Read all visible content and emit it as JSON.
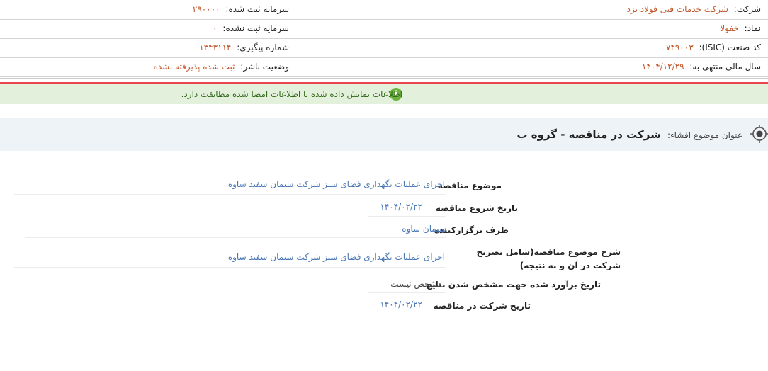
{
  "company_info": {
    "company_label": "شرکت:",
    "company_value": "شرکت خدمات فنی فولاد یزد",
    "symbol_label": "نماد:",
    "symbol_value": "خفولا",
    "isic_label": "کد صنعت (ISIC):",
    "isic_value": "۷۴۹۰۰۳",
    "fiscal_label": "سال مالی منتهی به:",
    "fiscal_value": "۱۴۰۴/۱۲/۲۹",
    "reg_capital_label": "سرمایه ثبت شده:",
    "reg_capital_value": "۲۹۰۰۰۰",
    "unreg_capital_label": "سرمایه ثبت نشده:",
    "unreg_capital_value": "۰",
    "tracking_label": "شماره پیگیری:",
    "tracking_value": "۱۳۴۳۱۱۴",
    "publisher_status_label": "وضعیت ناشر:",
    "publisher_status_value": "ثبت شده پذیرفته نشده"
  },
  "notice": {
    "text": "اطلاعات نمایش داده شده با اطلاعات امضا شده مطابقت دارد."
  },
  "topic": {
    "label": "عنوان موضوع افشاء:",
    "value": "شرکت در مناقصه - گروه ب"
  },
  "details": [
    {
      "label": "موضوع مناقصه",
      "value": "اجرای عملیات نگهداری فضای سبز شرکت سیمان سفید ساوه"
    },
    {
      "label": "تاریخ شروع مناقصه",
      "value": "۱۴۰۴/۰۲/۲۲"
    },
    {
      "label": "طرف برگزارکننده",
      "value": "سیمان ساوه"
    },
    {
      "label": "شرح موضوع مناقصه(شامل تصریح شرکت در آن و نه نتیجه)",
      "value": "اجرای عملیات نگهداری فضای سبز شرکت سیمان سفید ساوه"
    },
    {
      "label": "تاریخ برآورد شده جهت مشخص شدن نتایج",
      "value": "مشخص نیست"
    },
    {
      "label": "تاریخ شرکت در مناقصه",
      "value": "۱۴۰۴/۰۲/۲۲"
    }
  ],
  "icons": {
    "info": "info-icon",
    "target": "target-icon"
  },
  "colors": {
    "value_text": "#c0582b",
    "link_text": "#4a78b5",
    "notice_bg": "#e2f0dc",
    "notice_text": "#35691a",
    "alert_border": "#e8454f",
    "topic_bg": "#eef3f8"
  }
}
